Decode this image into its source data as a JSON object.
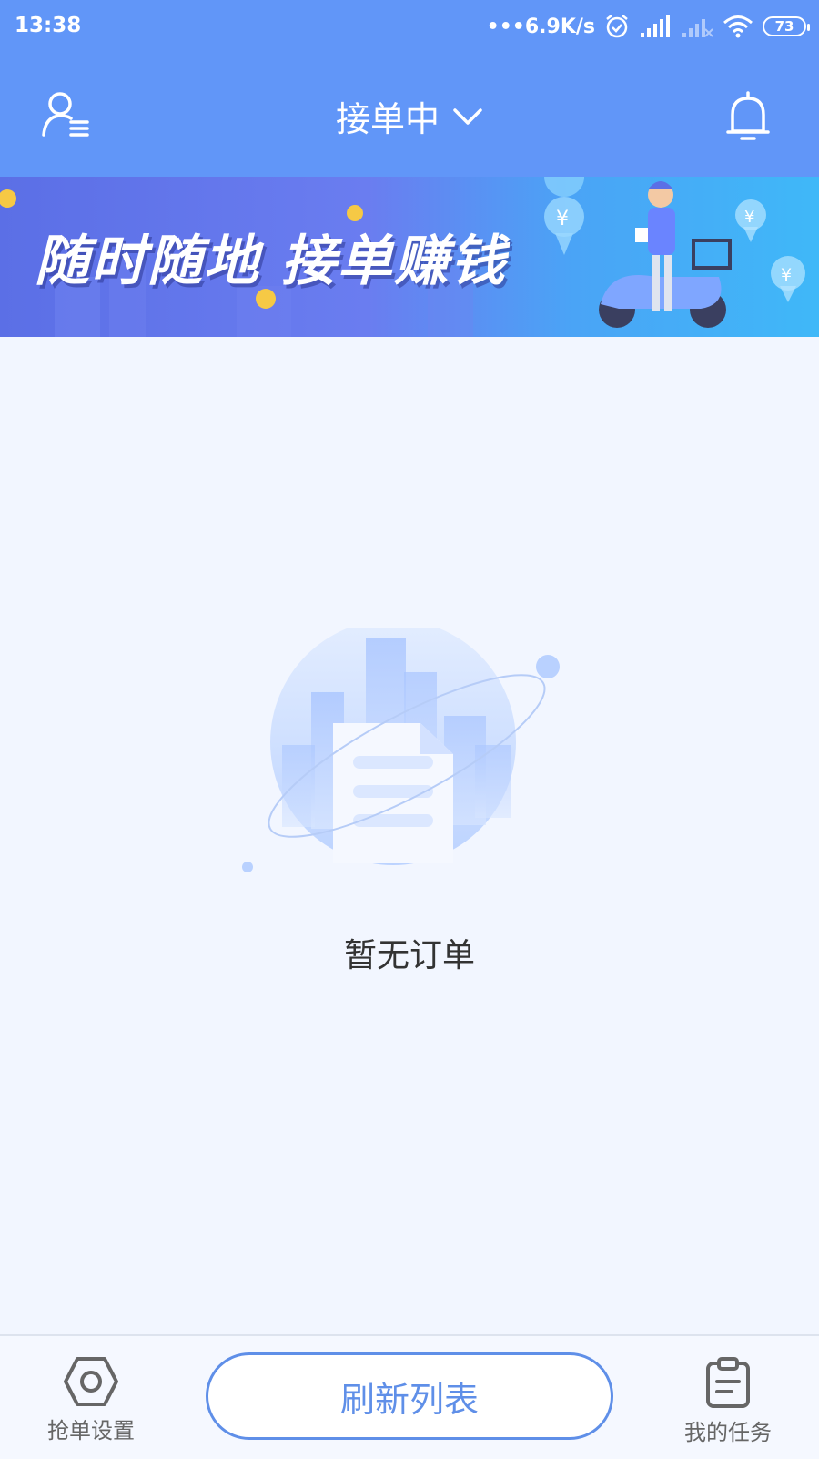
{
  "status_bar": {
    "time": "13:38",
    "net_speed": "•••6.9K/s",
    "battery": "73",
    "icons": [
      "alarm-icon",
      "signal-icon",
      "signal-weak-icon",
      "wifi-icon",
      "battery-icon"
    ]
  },
  "header": {
    "title": "接单中",
    "left_icon": "user-menu-icon",
    "right_icon": "bell-icon",
    "accent": "#6196f8"
  },
  "banner": {
    "text": "随时随地 接单赚钱"
  },
  "main": {
    "empty_text": "暂无订单",
    "empty_icon": "document-planet-icon"
  },
  "bottom_bar": {
    "left_tab": {
      "label": "抢单设置",
      "icon": "settings-hex-icon"
    },
    "refresh_label": "刷新列表",
    "right_tab": {
      "label": "我的任务",
      "icon": "clipboard-icon"
    },
    "button_color": "#5f8fe8"
  }
}
